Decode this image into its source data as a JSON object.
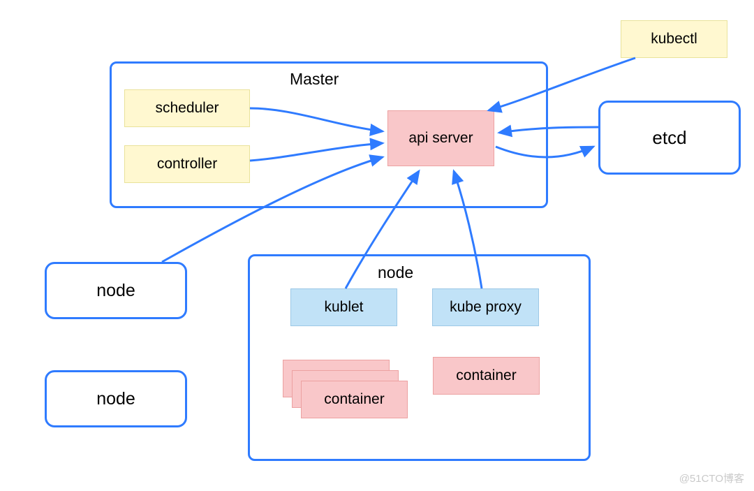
{
  "kubectl": "kubectl",
  "master": {
    "title": "Master",
    "scheduler": "scheduler",
    "controller": "controller",
    "api_server": "api server"
  },
  "etcd": "etcd",
  "node_left_1": "node",
  "node_left_2": "node",
  "node_detail": {
    "title": "node",
    "kublet": "kublet",
    "kube_proxy": "kube proxy",
    "container_stack": "container",
    "container_single": "container"
  },
  "watermark": "@51CTO博客"
}
